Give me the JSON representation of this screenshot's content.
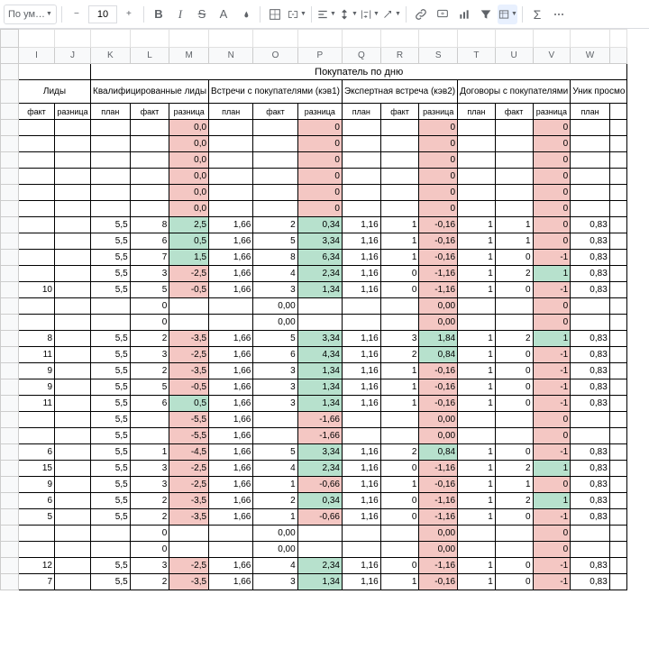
{
  "toolbar": {
    "font": "По ум…",
    "zoom": "10"
  },
  "cols": [
    "I",
    "J",
    "K",
    "L",
    "M",
    "N",
    "O",
    "P",
    "Q",
    "R",
    "S",
    "T",
    "U",
    "V",
    "W"
  ],
  "super": "Покупатель по дню",
  "groups": [
    "Лиды",
    "Квалифицированные лиды",
    "Встречи с покупателями (кэв1)",
    "Экспертная встреча (кэв2)",
    "Договоры с покупателями",
    "Уник просмо"
  ],
  "sub": [
    "факт",
    "разница",
    "план",
    "факт",
    "разница",
    "план",
    "факт",
    "разница",
    "план",
    "факт",
    "разница",
    "план",
    "факт",
    "разница",
    "план"
  ],
  "rows": [
    [
      "",
      "",
      "",
      "",
      "0,0",
      "",
      "",
      "0",
      "",
      "",
      "0",
      "",
      "",
      "0",
      ""
    ],
    [
      "",
      "",
      "",
      "",
      "0,0",
      "",
      "",
      "0",
      "",
      "",
      "0",
      "",
      "",
      "0",
      ""
    ],
    [
      "",
      "",
      "",
      "",
      "0,0",
      "",
      "",
      "0",
      "",
      "",
      "0",
      "",
      "",
      "0",
      ""
    ],
    [
      "",
      "",
      "",
      "",
      "0,0",
      "",
      "",
      "0",
      "",
      "",
      "0",
      "",
      "",
      "0",
      ""
    ],
    [
      "",
      "",
      "",
      "",
      "0,0",
      "",
      "",
      "0",
      "",
      "",
      "0",
      "",
      "",
      "0",
      ""
    ],
    [
      "",
      "",
      "",
      "",
      "0,0",
      "",
      "",
      "0",
      "",
      "",
      "0",
      "",
      "",
      "0",
      ""
    ],
    [
      "",
      "",
      "5,5",
      "8",
      "2,5",
      "1,66",
      "2",
      "0,34",
      "1,16",
      "1",
      "-0,16",
      "1",
      "1",
      "0",
      "0,83"
    ],
    [
      "",
      "",
      "5,5",
      "6",
      "0,5",
      "1,66",
      "5",
      "3,34",
      "1,16",
      "1",
      "-0,16",
      "1",
      "1",
      "0",
      "0,83"
    ],
    [
      "",
      "",
      "5,5",
      "7",
      "1,5",
      "1,66",
      "8",
      "6,34",
      "1,16",
      "1",
      "-0,16",
      "1",
      "0",
      "-1",
      "0,83"
    ],
    [
      "",
      "",
      "5,5",
      "3",
      "-2,5",
      "1,66",
      "4",
      "2,34",
      "1,16",
      "0",
      "-1,16",
      "1",
      "2",
      "1",
      "0,83"
    ],
    [
      "10",
      "",
      "5,5",
      "5",
      "-0,5",
      "1,66",
      "3",
      "1,34",
      "1,16",
      "0",
      "-1,16",
      "1",
      "0",
      "-1",
      "0,83"
    ],
    [
      "",
      "",
      "",
      "0",
      "",
      "",
      "0,00",
      "",
      "",
      "",
      "0,00",
      "",
      "",
      "0",
      ""
    ],
    [
      "",
      "",
      "",
      "0",
      "",
      "",
      "0,00",
      "",
      "",
      "",
      "0,00",
      "",
      "",
      "0",
      ""
    ],
    [
      "8",
      "",
      "5,5",
      "2",
      "-3,5",
      "1,66",
      "5",
      "3,34",
      "1,16",
      "3",
      "1,84",
      "1",
      "2",
      "1",
      "0,83"
    ],
    [
      "11",
      "",
      "5,5",
      "3",
      "-2,5",
      "1,66",
      "6",
      "4,34",
      "1,16",
      "2",
      "0,84",
      "1",
      "0",
      "-1",
      "0,83"
    ],
    [
      "9",
      "",
      "5,5",
      "2",
      "-3,5",
      "1,66",
      "3",
      "1,34",
      "1,16",
      "1",
      "-0,16",
      "1",
      "0",
      "-1",
      "0,83"
    ],
    [
      "9",
      "",
      "5,5",
      "5",
      "-0,5",
      "1,66",
      "3",
      "1,34",
      "1,16",
      "1",
      "-0,16",
      "1",
      "0",
      "-1",
      "0,83"
    ],
    [
      "11",
      "",
      "5,5",
      "6",
      "0,5",
      "1,66",
      "3",
      "1,34",
      "1,16",
      "1",
      "-0,16",
      "1",
      "0",
      "-1",
      "0,83"
    ],
    [
      "",
      "",
      "5,5",
      "",
      "-5,5",
      "1,66",
      "",
      "-1,66",
      "",
      "",
      "0,00",
      "",
      "",
      "0",
      ""
    ],
    [
      "",
      "",
      "5,5",
      "",
      "-5,5",
      "1,66",
      "",
      "-1,66",
      "",
      "",
      "0,00",
      "",
      "",
      "0",
      ""
    ],
    [
      "6",
      "",
      "5,5",
      "1",
      "-4,5",
      "1,66",
      "5",
      "3,34",
      "1,16",
      "2",
      "0,84",
      "1",
      "0",
      "-1",
      "0,83"
    ],
    [
      "15",
      "",
      "5,5",
      "3",
      "-2,5",
      "1,66",
      "4",
      "2,34",
      "1,16",
      "0",
      "-1,16",
      "1",
      "2",
      "1",
      "0,83"
    ],
    [
      "9",
      "",
      "5,5",
      "3",
      "-2,5",
      "1,66",
      "1",
      "-0,66",
      "1,16",
      "1",
      "-0,16",
      "1",
      "1",
      "0",
      "0,83"
    ],
    [
      "6",
      "",
      "5,5",
      "2",
      "-3,5",
      "1,66",
      "2",
      "0,34",
      "1,16",
      "0",
      "-1,16",
      "1",
      "2",
      "1",
      "0,83"
    ],
    [
      "5",
      "",
      "5,5",
      "2",
      "-3,5",
      "1,66",
      "1",
      "-0,66",
      "1,16",
      "0",
      "-1,16",
      "1",
      "0",
      "-1",
      "0,83"
    ],
    [
      "",
      "",
      "",
      "0",
      "",
      "",
      "0,00",
      "",
      "",
      "",
      "0,00",
      "",
      "",
      "0",
      ""
    ],
    [
      "",
      "",
      "",
      "0",
      "",
      "",
      "0,00",
      "",
      "",
      "",
      "0,00",
      "",
      "",
      "0",
      ""
    ],
    [
      "12",
      "",
      "5,5",
      "3",
      "-2,5",
      "1,66",
      "4",
      "2,34",
      "1,16",
      "0",
      "-1,16",
      "1",
      "0",
      "-1",
      "0,83"
    ],
    [
      "7",
      "",
      "5,5",
      "2",
      "-3,5",
      "1,66",
      "3",
      "1,34",
      "1,16",
      "1",
      "-0,16",
      "1",
      "0",
      "-1",
      "0,83"
    ]
  ],
  "hl": {
    "4": {
      "g": [
        [
          6,
          2
        ],
        [
          6,
          3
        ],
        [
          6,
          4
        ],
        [
          6,
          5
        ],
        [
          9,
          4
        ]
      ],
      "r": [
        [
          7,
          1
        ],
        [
          7,
          2
        ],
        [
          7,
          3
        ],
        [
          7,
          4
        ],
        [
          7,
          5
        ],
        [
          7,
          6
        ],
        [
          7,
          7
        ],
        [
          7,
          8
        ],
        [
          7,
          9
        ]
      ]
    },
    "7": {
      "g": [
        [
          6,
          2
        ],
        [
          6,
          3
        ],
        [
          6,
          4
        ],
        [
          7,
          2
        ],
        [
          7,
          4
        ],
        [
          7,
          5
        ],
        [
          7,
          6
        ],
        [
          7,
          7
        ],
        [
          7,
          8
        ]
      ],
      "r": [
        [
          6,
          5
        ],
        [
          6,
          6
        ],
        [
          6,
          7
        ],
        [
          6,
          8
        ],
        [
          6,
          9
        ],
        [
          7,
          1
        ],
        [
          7,
          3
        ]
      ]
    },
    "10": {
      "g": [
        [
          9,
          4
        ],
        [
          9,
          5
        ],
        [
          9,
          7
        ],
        [
          9,
          8
        ],
        [
          7,
          6
        ]
      ],
      "r": [
        [
          6,
          2
        ],
        [
          6,
          3
        ],
        [
          6,
          4
        ],
        [
          6,
          5
        ],
        [
          6,
          6
        ],
        [
          6,
          7
        ],
        [
          6,
          8
        ],
        [
          6,
          9
        ],
        [
          9,
          1
        ],
        [
          9,
          2
        ],
        [
          9,
          3
        ],
        [
          9,
          6
        ],
        [
          7,
          1
        ],
        [
          7,
          2
        ],
        [
          7,
          3
        ],
        [
          7,
          4
        ],
        [
          7,
          5
        ],
        [
          7,
          7
        ],
        [
          7,
          8
        ],
        [
          7,
          9
        ],
        [
          9,
          9
        ]
      ]
    },
    "13": {
      "g": [
        [
          9,
          4
        ],
        [
          9,
          5
        ],
        [
          9,
          7
        ],
        [
          9,
          8
        ],
        [
          7,
          6
        ],
        [
          7,
          9
        ]
      ],
      "r": [
        [
          6,
          2
        ],
        [
          6,
          3
        ],
        [
          6,
          4
        ],
        [
          6,
          5
        ],
        [
          6,
          6
        ],
        [
          6,
          7
        ],
        [
          6,
          8
        ],
        [
          6,
          9
        ],
        [
          9,
          1
        ],
        [
          9,
          2
        ],
        [
          9,
          3
        ],
        [
          9,
          6
        ],
        [
          7,
          1
        ],
        [
          7,
          2
        ],
        [
          7,
          3
        ],
        [
          7,
          4
        ],
        [
          7,
          5
        ],
        [
          7,
          7
        ],
        [
          7,
          8
        ]
      ]
    }
  }
}
